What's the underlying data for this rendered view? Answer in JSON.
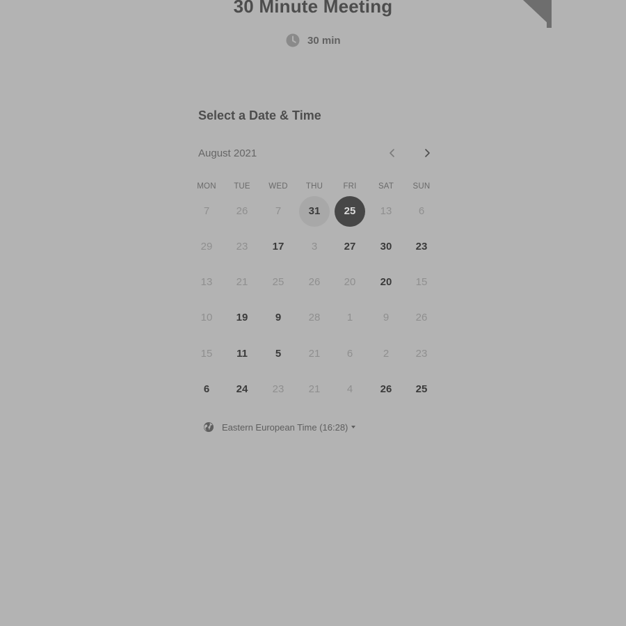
{
  "event": {
    "title": "30 Minute Meeting",
    "duration": "30 min",
    "duration_icon": "clock-icon"
  },
  "scheduler": {
    "title": "Select a Date & Time",
    "month": "August 2021",
    "prev_icon": "chevron-left-icon",
    "next_icon": "chevron-right-icon",
    "weekdays": [
      "MON",
      "TUE",
      "WED",
      "THU",
      "FRI",
      "SAT",
      "SUN"
    ],
    "weeks": [
      [
        {
          "label": "7",
          "available": false
        },
        {
          "label": "26",
          "available": false
        },
        {
          "label": "7",
          "available": false
        },
        {
          "label": "31",
          "available": true,
          "state": "hover"
        },
        {
          "label": "25",
          "available": true,
          "state": "selected"
        },
        {
          "label": "13",
          "available": false
        },
        {
          "label": "6",
          "available": false
        }
      ],
      [
        {
          "label": "29",
          "available": false
        },
        {
          "label": "23",
          "available": false
        },
        {
          "label": "17",
          "available": true
        },
        {
          "label": "3",
          "available": false
        },
        {
          "label": "27",
          "available": true
        },
        {
          "label": "30",
          "available": true
        },
        {
          "label": "23",
          "available": true
        }
      ],
      [
        {
          "label": "13",
          "available": false
        },
        {
          "label": "21",
          "available": false
        },
        {
          "label": "25",
          "available": false
        },
        {
          "label": "26",
          "available": false
        },
        {
          "label": "20",
          "available": false
        },
        {
          "label": "20",
          "available": true
        },
        {
          "label": "15",
          "available": false
        }
      ],
      [
        {
          "label": "10",
          "available": false
        },
        {
          "label": "19",
          "available": true
        },
        {
          "label": "9",
          "available": true
        },
        {
          "label": "28",
          "available": false
        },
        {
          "label": "1",
          "available": false
        },
        {
          "label": "9",
          "available": false
        },
        {
          "label": "26",
          "available": false
        }
      ],
      [
        {
          "label": "15",
          "available": false
        },
        {
          "label": "11",
          "available": true
        },
        {
          "label": "5",
          "available": true
        },
        {
          "label": "21",
          "available": false
        },
        {
          "label": "6",
          "available": false
        },
        {
          "label": "2",
          "available": false
        },
        {
          "label": "23",
          "available": false
        }
      ],
      [
        {
          "label": "6",
          "available": true
        },
        {
          "label": "24",
          "available": true
        },
        {
          "label": "23",
          "available": false
        },
        {
          "label": "21",
          "available": false
        },
        {
          "label": "4",
          "available": false
        },
        {
          "label": "26",
          "available": true
        },
        {
          "label": "25",
          "available": true
        }
      ]
    ],
    "timezone": {
      "label": "Eastern European Time (16:28)",
      "icon": "globe-icon",
      "dropdown_icon": "caret-down-icon"
    }
  },
  "colors": {
    "background": "#b3b3b3",
    "selected_day": "#474747",
    "ribbon": "#6e6e6e"
  }
}
